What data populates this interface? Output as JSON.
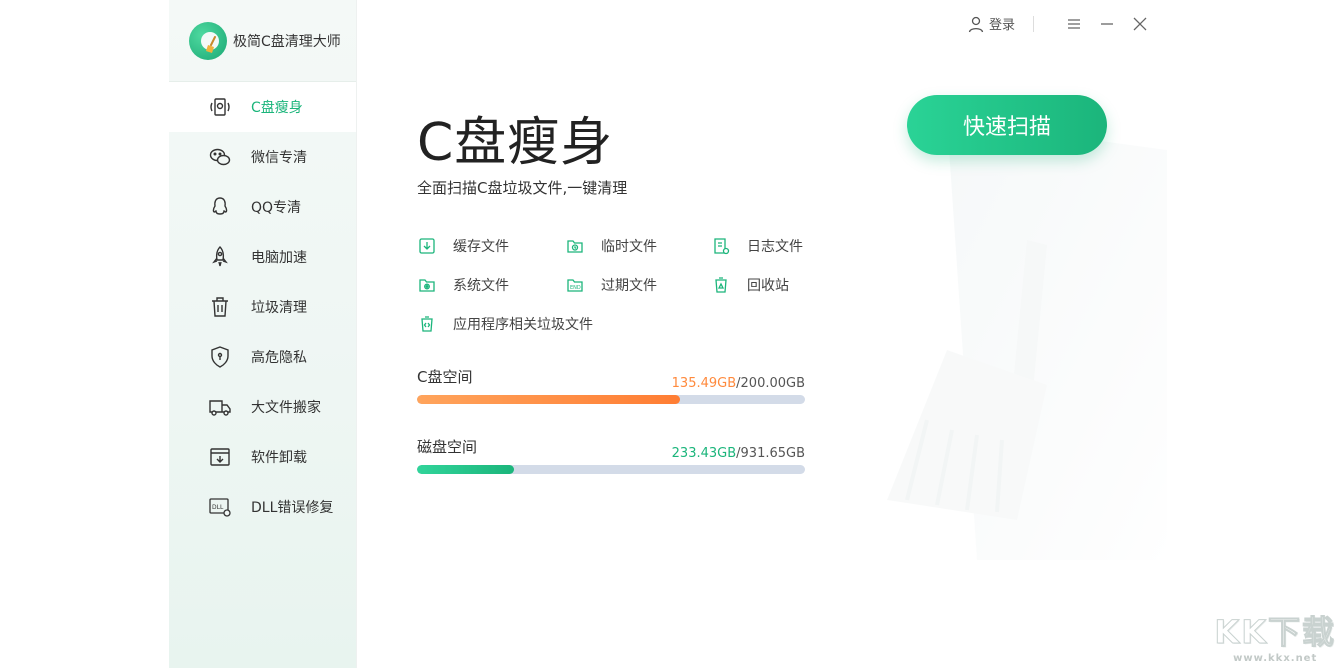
{
  "app": {
    "name": "极简C盘清理大师"
  },
  "topbar": {
    "login_label": "登录"
  },
  "sidebar": {
    "items": [
      {
        "label": "C盘瘦身",
        "icon": "disk-slim-icon",
        "active": true
      },
      {
        "label": "微信专清",
        "icon": "wechat-icon",
        "active": false
      },
      {
        "label": "QQ专清",
        "icon": "qq-icon",
        "active": false
      },
      {
        "label": "电脑加速",
        "icon": "rocket-icon",
        "active": false
      },
      {
        "label": "垃圾清理",
        "icon": "trash-icon",
        "active": false
      },
      {
        "label": "高危隐私",
        "icon": "shield-icon",
        "active": false
      },
      {
        "label": "大文件搬家",
        "icon": "truck-icon",
        "active": false
      },
      {
        "label": "软件卸载",
        "icon": "uninstall-icon",
        "active": false
      },
      {
        "label": "DLL错误修复",
        "icon": "dll-icon",
        "active": false
      }
    ]
  },
  "main": {
    "title": "C盘瘦身",
    "subtitle": "全面扫描C盘垃圾文件,一键清理",
    "scan_button": "快速扫描",
    "file_types": [
      {
        "label": "缓存文件",
        "icon": "cache-file-icon"
      },
      {
        "label": "临时文件",
        "icon": "temp-file-icon"
      },
      {
        "label": "日志文件",
        "icon": "log-file-icon"
      },
      {
        "label": "系统文件",
        "icon": "system-file-icon"
      },
      {
        "label": "过期文件",
        "icon": "expired-file-icon"
      },
      {
        "label": "回收站",
        "icon": "recycle-bin-icon"
      },
      {
        "label": "应用程序相关垃圾文件",
        "icon": "app-junk-icon"
      }
    ],
    "c_space": {
      "label": "C盘空间",
      "used": "135.49GB",
      "total": "/200.00GB",
      "used_fraction": 0.6775
    },
    "disk_space": {
      "label": "磁盘空间",
      "used": "233.43GB",
      "total": "/931.65GB",
      "used_fraction": 0.2505
    }
  },
  "watermark": {
    "text": "KK下载",
    "url": "www.kkx.net"
  },
  "colors": {
    "accent": "#1bb57b",
    "orange": "#ff8a3d",
    "track": "#d3dbe8"
  }
}
